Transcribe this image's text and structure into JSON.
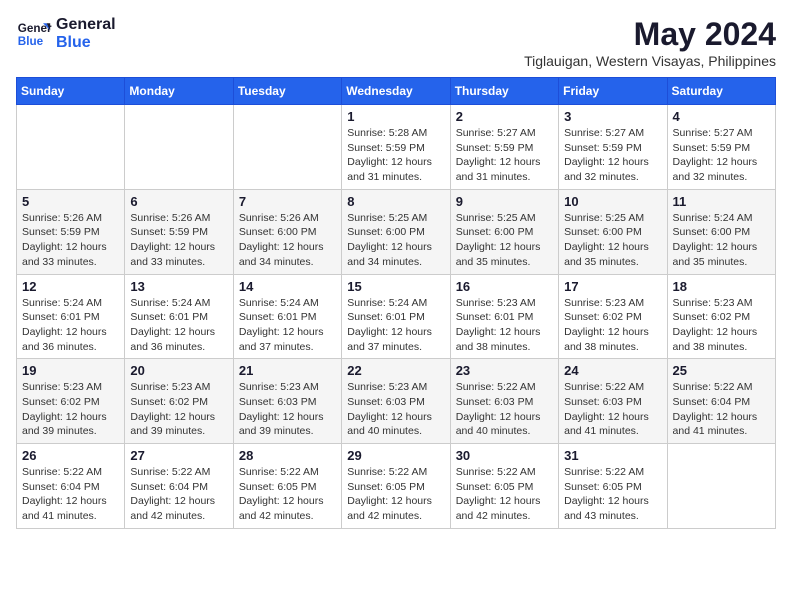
{
  "header": {
    "logo_line1": "General",
    "logo_line2": "Blue",
    "month_year": "May 2024",
    "location": "Tiglauigan, Western Visayas, Philippines"
  },
  "days_of_week": [
    "Sunday",
    "Monday",
    "Tuesday",
    "Wednesday",
    "Thursday",
    "Friday",
    "Saturday"
  ],
  "weeks": [
    [
      {
        "day": "",
        "info": ""
      },
      {
        "day": "",
        "info": ""
      },
      {
        "day": "",
        "info": ""
      },
      {
        "day": "1",
        "info": "Sunrise: 5:28 AM\nSunset: 5:59 PM\nDaylight: 12 hours\nand 31 minutes."
      },
      {
        "day": "2",
        "info": "Sunrise: 5:27 AM\nSunset: 5:59 PM\nDaylight: 12 hours\nand 31 minutes."
      },
      {
        "day": "3",
        "info": "Sunrise: 5:27 AM\nSunset: 5:59 PM\nDaylight: 12 hours\nand 32 minutes."
      },
      {
        "day": "4",
        "info": "Sunrise: 5:27 AM\nSunset: 5:59 PM\nDaylight: 12 hours\nand 32 minutes."
      }
    ],
    [
      {
        "day": "5",
        "info": "Sunrise: 5:26 AM\nSunset: 5:59 PM\nDaylight: 12 hours\nand 33 minutes."
      },
      {
        "day": "6",
        "info": "Sunrise: 5:26 AM\nSunset: 5:59 PM\nDaylight: 12 hours\nand 33 minutes."
      },
      {
        "day": "7",
        "info": "Sunrise: 5:26 AM\nSunset: 6:00 PM\nDaylight: 12 hours\nand 34 minutes."
      },
      {
        "day": "8",
        "info": "Sunrise: 5:25 AM\nSunset: 6:00 PM\nDaylight: 12 hours\nand 34 minutes."
      },
      {
        "day": "9",
        "info": "Sunrise: 5:25 AM\nSunset: 6:00 PM\nDaylight: 12 hours\nand 35 minutes."
      },
      {
        "day": "10",
        "info": "Sunrise: 5:25 AM\nSunset: 6:00 PM\nDaylight: 12 hours\nand 35 minutes."
      },
      {
        "day": "11",
        "info": "Sunrise: 5:24 AM\nSunset: 6:00 PM\nDaylight: 12 hours\nand 35 minutes."
      }
    ],
    [
      {
        "day": "12",
        "info": "Sunrise: 5:24 AM\nSunset: 6:01 PM\nDaylight: 12 hours\nand 36 minutes."
      },
      {
        "day": "13",
        "info": "Sunrise: 5:24 AM\nSunset: 6:01 PM\nDaylight: 12 hours\nand 36 minutes."
      },
      {
        "day": "14",
        "info": "Sunrise: 5:24 AM\nSunset: 6:01 PM\nDaylight: 12 hours\nand 37 minutes."
      },
      {
        "day": "15",
        "info": "Sunrise: 5:24 AM\nSunset: 6:01 PM\nDaylight: 12 hours\nand 37 minutes."
      },
      {
        "day": "16",
        "info": "Sunrise: 5:23 AM\nSunset: 6:01 PM\nDaylight: 12 hours\nand 38 minutes."
      },
      {
        "day": "17",
        "info": "Sunrise: 5:23 AM\nSunset: 6:02 PM\nDaylight: 12 hours\nand 38 minutes."
      },
      {
        "day": "18",
        "info": "Sunrise: 5:23 AM\nSunset: 6:02 PM\nDaylight: 12 hours\nand 38 minutes."
      }
    ],
    [
      {
        "day": "19",
        "info": "Sunrise: 5:23 AM\nSunset: 6:02 PM\nDaylight: 12 hours\nand 39 minutes."
      },
      {
        "day": "20",
        "info": "Sunrise: 5:23 AM\nSunset: 6:02 PM\nDaylight: 12 hours\nand 39 minutes."
      },
      {
        "day": "21",
        "info": "Sunrise: 5:23 AM\nSunset: 6:03 PM\nDaylight: 12 hours\nand 39 minutes."
      },
      {
        "day": "22",
        "info": "Sunrise: 5:23 AM\nSunset: 6:03 PM\nDaylight: 12 hours\nand 40 minutes."
      },
      {
        "day": "23",
        "info": "Sunrise: 5:22 AM\nSunset: 6:03 PM\nDaylight: 12 hours\nand 40 minutes."
      },
      {
        "day": "24",
        "info": "Sunrise: 5:22 AM\nSunset: 6:03 PM\nDaylight: 12 hours\nand 41 minutes."
      },
      {
        "day": "25",
        "info": "Sunrise: 5:22 AM\nSunset: 6:04 PM\nDaylight: 12 hours\nand 41 minutes."
      }
    ],
    [
      {
        "day": "26",
        "info": "Sunrise: 5:22 AM\nSunset: 6:04 PM\nDaylight: 12 hours\nand 41 minutes."
      },
      {
        "day": "27",
        "info": "Sunrise: 5:22 AM\nSunset: 6:04 PM\nDaylight: 12 hours\nand 42 minutes."
      },
      {
        "day": "28",
        "info": "Sunrise: 5:22 AM\nSunset: 6:05 PM\nDaylight: 12 hours\nand 42 minutes."
      },
      {
        "day": "29",
        "info": "Sunrise: 5:22 AM\nSunset: 6:05 PM\nDaylight: 12 hours\nand 42 minutes."
      },
      {
        "day": "30",
        "info": "Sunrise: 5:22 AM\nSunset: 6:05 PM\nDaylight: 12 hours\nand 42 minutes."
      },
      {
        "day": "31",
        "info": "Sunrise: 5:22 AM\nSunset: 6:05 PM\nDaylight: 12 hours\nand 43 minutes."
      },
      {
        "day": "",
        "info": ""
      }
    ]
  ]
}
